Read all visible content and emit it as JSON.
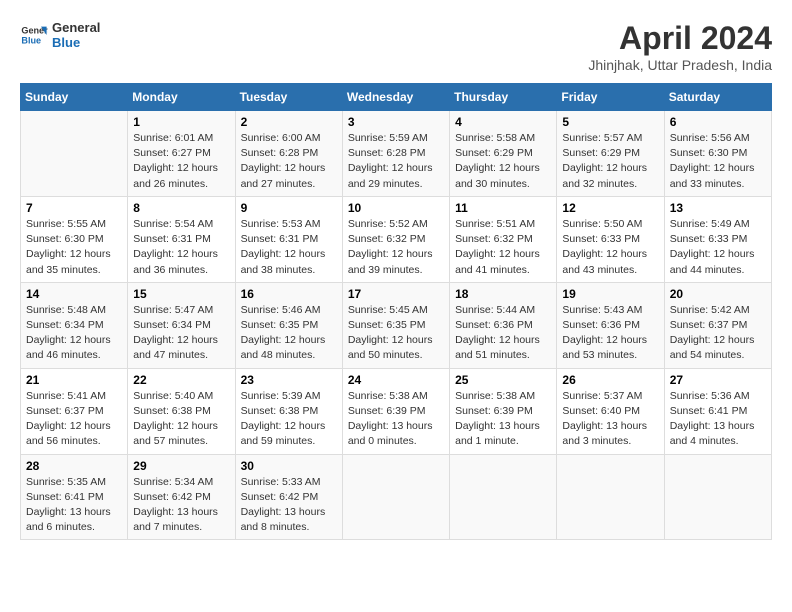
{
  "logo": {
    "line1": "General",
    "line2": "Blue"
  },
  "title": "April 2024",
  "subtitle": "Jhinjhak, Uttar Pradesh, India",
  "days_header": [
    "Sunday",
    "Monday",
    "Tuesday",
    "Wednesday",
    "Thursday",
    "Friday",
    "Saturday"
  ],
  "weeks": [
    [
      {
        "num": "",
        "info": ""
      },
      {
        "num": "1",
        "info": "Sunrise: 6:01 AM\nSunset: 6:27 PM\nDaylight: 12 hours\nand 26 minutes."
      },
      {
        "num": "2",
        "info": "Sunrise: 6:00 AM\nSunset: 6:28 PM\nDaylight: 12 hours\nand 27 minutes."
      },
      {
        "num": "3",
        "info": "Sunrise: 5:59 AM\nSunset: 6:28 PM\nDaylight: 12 hours\nand 29 minutes."
      },
      {
        "num": "4",
        "info": "Sunrise: 5:58 AM\nSunset: 6:29 PM\nDaylight: 12 hours\nand 30 minutes."
      },
      {
        "num": "5",
        "info": "Sunrise: 5:57 AM\nSunset: 6:29 PM\nDaylight: 12 hours\nand 32 minutes."
      },
      {
        "num": "6",
        "info": "Sunrise: 5:56 AM\nSunset: 6:30 PM\nDaylight: 12 hours\nand 33 minutes."
      }
    ],
    [
      {
        "num": "7",
        "info": "Sunrise: 5:55 AM\nSunset: 6:30 PM\nDaylight: 12 hours\nand 35 minutes."
      },
      {
        "num": "8",
        "info": "Sunrise: 5:54 AM\nSunset: 6:31 PM\nDaylight: 12 hours\nand 36 minutes."
      },
      {
        "num": "9",
        "info": "Sunrise: 5:53 AM\nSunset: 6:31 PM\nDaylight: 12 hours\nand 38 minutes."
      },
      {
        "num": "10",
        "info": "Sunrise: 5:52 AM\nSunset: 6:32 PM\nDaylight: 12 hours\nand 39 minutes."
      },
      {
        "num": "11",
        "info": "Sunrise: 5:51 AM\nSunset: 6:32 PM\nDaylight: 12 hours\nand 41 minutes."
      },
      {
        "num": "12",
        "info": "Sunrise: 5:50 AM\nSunset: 6:33 PM\nDaylight: 12 hours\nand 43 minutes."
      },
      {
        "num": "13",
        "info": "Sunrise: 5:49 AM\nSunset: 6:33 PM\nDaylight: 12 hours\nand 44 minutes."
      }
    ],
    [
      {
        "num": "14",
        "info": "Sunrise: 5:48 AM\nSunset: 6:34 PM\nDaylight: 12 hours\nand 46 minutes."
      },
      {
        "num": "15",
        "info": "Sunrise: 5:47 AM\nSunset: 6:34 PM\nDaylight: 12 hours\nand 47 minutes."
      },
      {
        "num": "16",
        "info": "Sunrise: 5:46 AM\nSunset: 6:35 PM\nDaylight: 12 hours\nand 48 minutes."
      },
      {
        "num": "17",
        "info": "Sunrise: 5:45 AM\nSunset: 6:35 PM\nDaylight: 12 hours\nand 50 minutes."
      },
      {
        "num": "18",
        "info": "Sunrise: 5:44 AM\nSunset: 6:36 PM\nDaylight: 12 hours\nand 51 minutes."
      },
      {
        "num": "19",
        "info": "Sunrise: 5:43 AM\nSunset: 6:36 PM\nDaylight: 12 hours\nand 53 minutes."
      },
      {
        "num": "20",
        "info": "Sunrise: 5:42 AM\nSunset: 6:37 PM\nDaylight: 12 hours\nand 54 minutes."
      }
    ],
    [
      {
        "num": "21",
        "info": "Sunrise: 5:41 AM\nSunset: 6:37 PM\nDaylight: 12 hours\nand 56 minutes."
      },
      {
        "num": "22",
        "info": "Sunrise: 5:40 AM\nSunset: 6:38 PM\nDaylight: 12 hours\nand 57 minutes."
      },
      {
        "num": "23",
        "info": "Sunrise: 5:39 AM\nSunset: 6:38 PM\nDaylight: 12 hours\nand 59 minutes."
      },
      {
        "num": "24",
        "info": "Sunrise: 5:38 AM\nSunset: 6:39 PM\nDaylight: 13 hours\nand 0 minutes."
      },
      {
        "num": "25",
        "info": "Sunrise: 5:38 AM\nSunset: 6:39 PM\nDaylight: 13 hours\nand 1 minute."
      },
      {
        "num": "26",
        "info": "Sunrise: 5:37 AM\nSunset: 6:40 PM\nDaylight: 13 hours\nand 3 minutes."
      },
      {
        "num": "27",
        "info": "Sunrise: 5:36 AM\nSunset: 6:41 PM\nDaylight: 13 hours\nand 4 minutes."
      }
    ],
    [
      {
        "num": "28",
        "info": "Sunrise: 5:35 AM\nSunset: 6:41 PM\nDaylight: 13 hours\nand 6 minutes."
      },
      {
        "num": "29",
        "info": "Sunrise: 5:34 AM\nSunset: 6:42 PM\nDaylight: 13 hours\nand 7 minutes."
      },
      {
        "num": "30",
        "info": "Sunrise: 5:33 AM\nSunset: 6:42 PM\nDaylight: 13 hours\nand 8 minutes."
      },
      {
        "num": "",
        "info": ""
      },
      {
        "num": "",
        "info": ""
      },
      {
        "num": "",
        "info": ""
      },
      {
        "num": "",
        "info": ""
      }
    ]
  ]
}
